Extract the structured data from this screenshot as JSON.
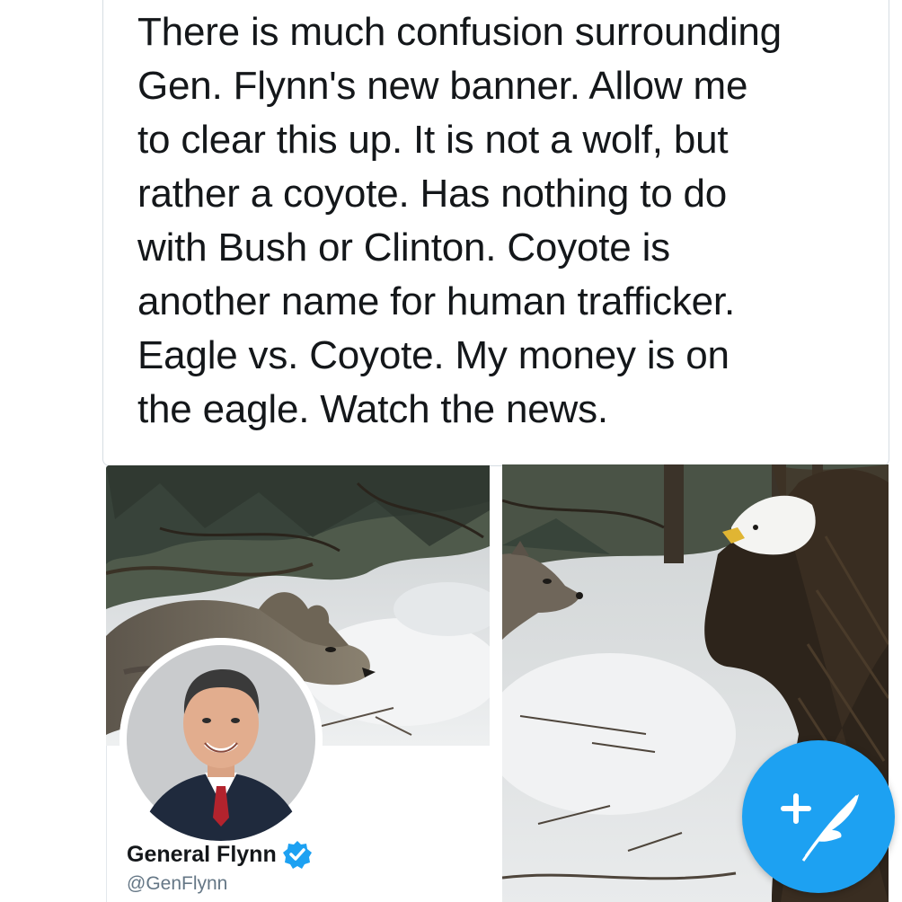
{
  "tweet": {
    "text": "There is much confusion surrounding\nGen. Flynn's new banner.  Allow me\nto clear this up.  It is not a wolf, but\nrather a coyote.  Has nothing to do\nwith Bush or Clinton.  Coyote is\nanother name for human trafficker.\nEagle vs. Coyote.  My money is on\nthe eagle.  Watch the news."
  },
  "media": {
    "left_image": "wolf-in-snowy-forest-photo",
    "right_image": "bald-eagle-facing-coyote-photo"
  },
  "profile": {
    "name": "General Flynn",
    "handle": "@GenFlynn",
    "verified": true,
    "avatar": "man-in-suit-portrait"
  },
  "compose": {
    "icon": "compose-feather-plus-icon"
  },
  "colors": {
    "text": "#14171a",
    "secondary_text": "#657786",
    "accent": "#1da1f2",
    "border": "#d6dde3"
  }
}
